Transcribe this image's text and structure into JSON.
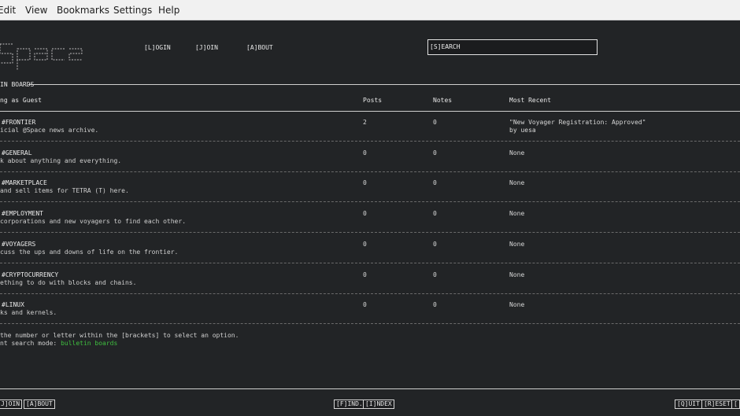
{
  "menubar": {
    "items": [
      "Edit",
      "View",
      "Bookmarks",
      "Settings",
      "Help"
    ]
  },
  "nav": {
    "login": "[L]OGIN",
    "join": "[J]OIN",
    "about": "[A]BOUT"
  },
  "search": {
    "label": "[S]EARCH"
  },
  "section": {
    "title": "IN BOARDS"
  },
  "table": {
    "headers": {
      "board": "ng as Guest",
      "posts": "Posts",
      "notes": "Notes",
      "recent": "Most Recent"
    },
    "rows": [
      {
        "name": "#FRONTIER",
        "desc": "icial @Space news archive.",
        "posts": "2",
        "notes": "0",
        "recent": "\"New Voyager Registration: Approved\"",
        "recent_by": "by uesa"
      },
      {
        "name": "#GENERAL",
        "desc": "k about anything and everything.",
        "posts": "0",
        "notes": "0",
        "recent": "None",
        "recent_by": ""
      },
      {
        "name": "#MARKETPLACE",
        "desc": " and sell items for TETRA (T) here.",
        "posts": "0",
        "notes": "0",
        "recent": "None",
        "recent_by": ""
      },
      {
        "name": "#EMPLOYMENT",
        "desc": " corporations and new voyagers to find each other.",
        "posts": "0",
        "notes": "0",
        "recent": "None",
        "recent_by": ""
      },
      {
        "name": "#VOYAGERS",
        "desc": "cuss the ups and downs of life on the frontier.",
        "posts": "0",
        "notes": "0",
        "recent": "None",
        "recent_by": ""
      },
      {
        "name": "#CRYPTOCURRENCY",
        "desc": "ething to do with blocks and chains.",
        "posts": "0",
        "notes": "0",
        "recent": "None",
        "recent_by": ""
      },
      {
        "name": "#LINUX",
        "desc": "ks and kernels.",
        "posts": "0",
        "notes": "0",
        "recent": "None",
        "recent_by": ""
      }
    ]
  },
  "help": {
    "line1": " the number or letter within the [brackets] to select an option.",
    "line2_prefix": "nt search mode: ",
    "line2_mode": "bulletin boards"
  },
  "footer": {
    "left": [
      "J]OIN",
      "[A]BOUT"
    ],
    "center": [
      "[F]IND..",
      "[I]NDEX"
    ],
    "right": [
      "[Q]UIT",
      "[R]ESET",
      "["
    ]
  },
  "colors": {
    "background": "#222426",
    "menubar": "#f1f1f1",
    "mode_highlight": "#3fbf3f"
  }
}
